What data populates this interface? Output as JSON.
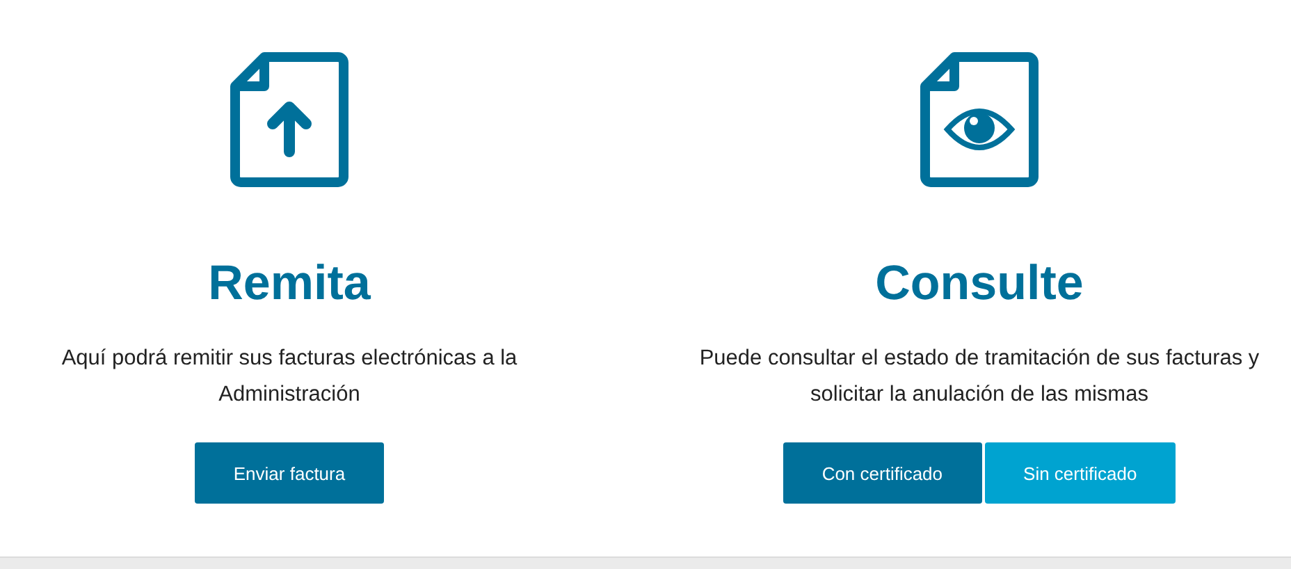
{
  "cards": [
    {
      "title": "Remita",
      "description": "Aquí podrá remitir sus facturas electrónicas a la Administración",
      "buttons": [
        {
          "label": "Enviar factura",
          "kind": "primary"
        }
      ]
    },
    {
      "title": "Consulte",
      "description": "Puede consultar el estado de tramitación de sus facturas y solicitar la anulación de las mismas",
      "buttons": [
        {
          "label": "Con certificado",
          "kind": "primary"
        },
        {
          "label": "Sin certificado",
          "kind": "secondary"
        }
      ]
    }
  ]
}
